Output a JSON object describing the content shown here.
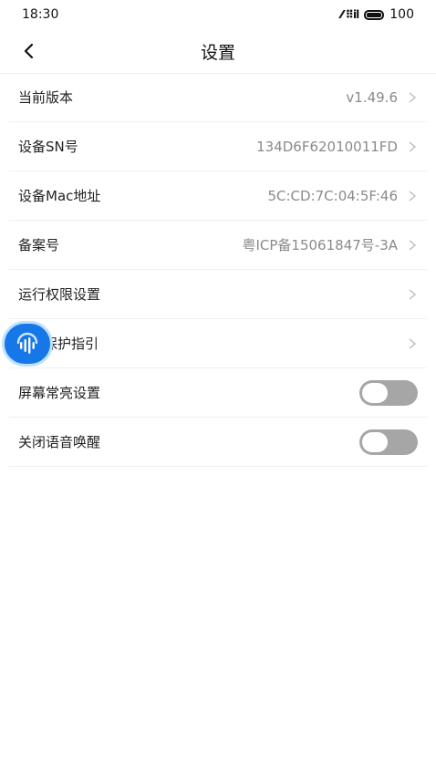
{
  "status_bar": {
    "time": "18:30",
    "signal_text": "∕∕ ❙❙l",
    "battery_level": "100"
  },
  "header": {
    "title": "设置",
    "back_icon": "chevron-left-icon"
  },
  "settings": [
    {
      "label": "当前版本",
      "value": "v1.49.6",
      "type": "link"
    },
    {
      "label": "设备SN号",
      "value": "134D6F62010011FD",
      "type": "link"
    },
    {
      "label": "设备Mac地址",
      "value": "5C:CD:7C:04:5F:46",
      "type": "link"
    },
    {
      "label": "备案号",
      "value": "粤ICP备15061847号-3A",
      "type": "link"
    },
    {
      "label": "运行权限设置",
      "value": "",
      "type": "link"
    },
    {
      "label": "保护指引",
      "value": "",
      "type": "link"
    },
    {
      "label": "屏幕常亮设置",
      "value": "",
      "type": "toggle",
      "on": false
    },
    {
      "label": "关闭语音唤醒",
      "value": "",
      "type": "toggle",
      "on": false
    }
  ],
  "floating_button": {
    "icon": "voice-wave-icon",
    "color": "#1677e8"
  },
  "colors": {
    "toggle_off": "#a6a6a6",
    "value_text": "#8a8a8a",
    "divider": "#f0f0f0"
  }
}
